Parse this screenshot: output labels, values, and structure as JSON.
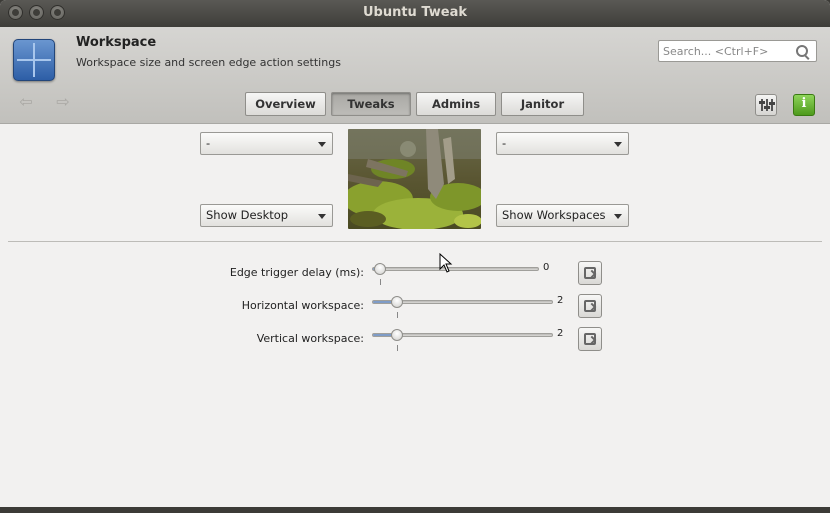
{
  "window": {
    "title": "Ubuntu Tweak"
  },
  "header": {
    "title": "Workspace",
    "subtitle": "Workspace size and screen edge action settings",
    "search_placeholder": "Search... <Ctrl+F>"
  },
  "nav": {
    "tabs": [
      {
        "label": "Overview",
        "active": false
      },
      {
        "label": "Tweaks",
        "active": true
      },
      {
        "label": "Admins",
        "active": false
      },
      {
        "label": "Janitor",
        "active": false
      }
    ]
  },
  "edge_actions": {
    "top_left": "-",
    "top_right": "-",
    "bottom_left": "Show Desktop",
    "bottom_right": "Show Workspaces"
  },
  "sliders": [
    {
      "label": "Edge trigger delay (ms):",
      "value": "0",
      "fraction": 0.0
    },
    {
      "label": "Horizontal workspace:",
      "value": "2",
      "fraction": 0.1
    },
    {
      "label": "Vertical workspace:",
      "value": "2",
      "fraction": 0.1
    }
  ],
  "colors": {
    "accent": "#7f9cc7",
    "titlebar": "#3e3d39",
    "background": "#f2f1f0"
  },
  "icons": [
    "close-icon",
    "minimize-icon",
    "maximize-icon",
    "workspace-app-icon",
    "search-icon",
    "back-arrow-icon",
    "forward-arrow-icon",
    "preferences-mixer-icon",
    "info-icon",
    "reset-icon"
  ]
}
